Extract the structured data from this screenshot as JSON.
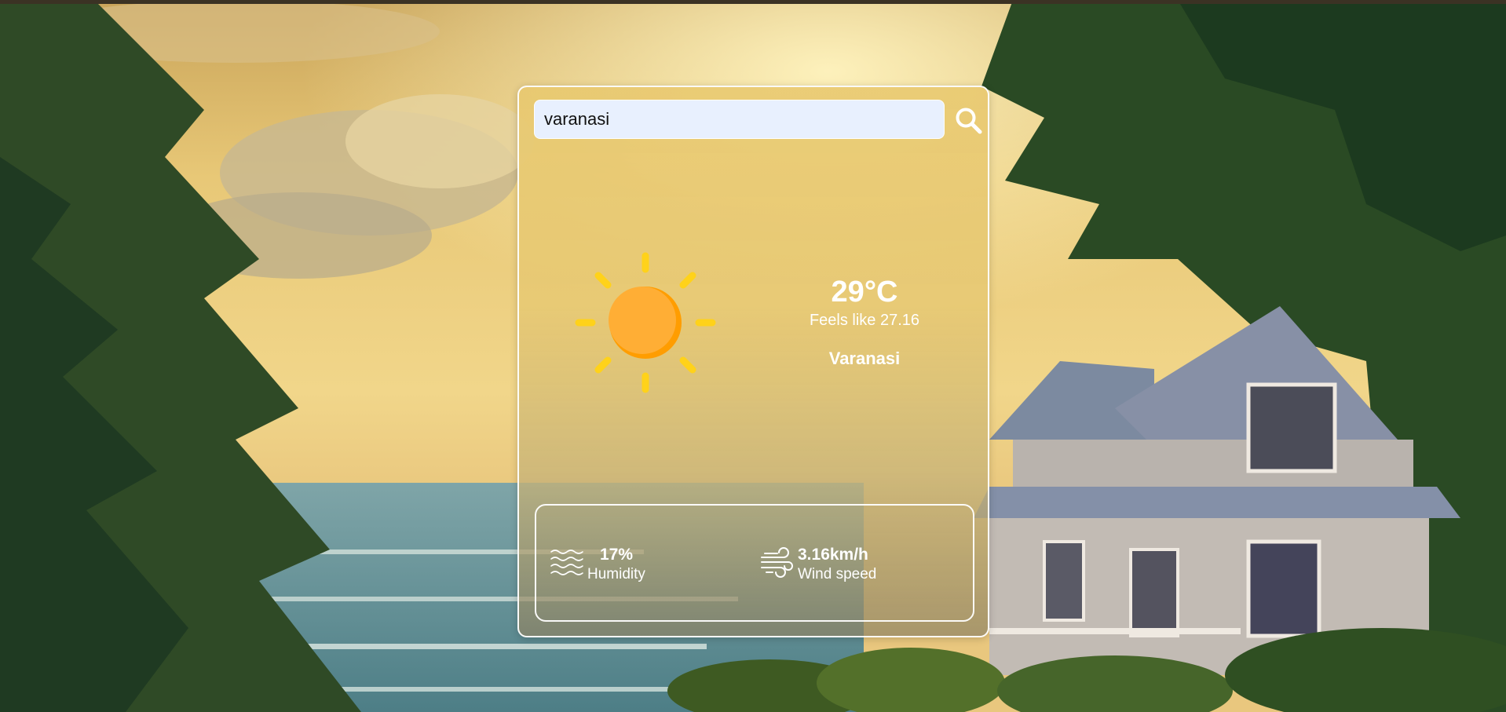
{
  "search": {
    "value": "varanasi",
    "button_icon": "search-icon"
  },
  "weather": {
    "icon": "sun-icon",
    "temperature": "29°C",
    "feels_like": "Feels like 27.16",
    "city": "Varanasi"
  },
  "details": {
    "humidity": {
      "icon": "humidity-waves-icon",
      "value": "17%",
      "label": "Humidity"
    },
    "wind": {
      "icon": "wind-icon",
      "value": "3.16km/h",
      "label": "Wind speed"
    }
  },
  "colors": {
    "sun": "#ffae35",
    "sun_shade": "#ff9d00",
    "sun_rays": "#ffd21a",
    "input_background": "#e8f0fe",
    "card_border": "#ffffff"
  }
}
